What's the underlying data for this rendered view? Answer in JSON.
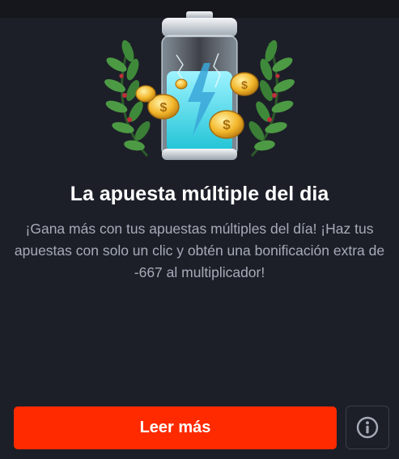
{
  "card": {
    "title": "La apuesta múltiple del dia",
    "description": "¡Gana más con tus apuestas múltiples del día! ¡Haz tus apuestas con solo un clic y obtén una bonificación extra de -667 al multiplicador!",
    "read_more_label": "Leer más"
  },
  "icons": {
    "hero": "battery-laurel-coins-icon",
    "info": "info-icon"
  },
  "colors": {
    "background": "#1c1f28",
    "accent": "#ff2a00",
    "title": "#ffffff",
    "text": "#a6abb8",
    "info_border": "#3a3e49"
  }
}
